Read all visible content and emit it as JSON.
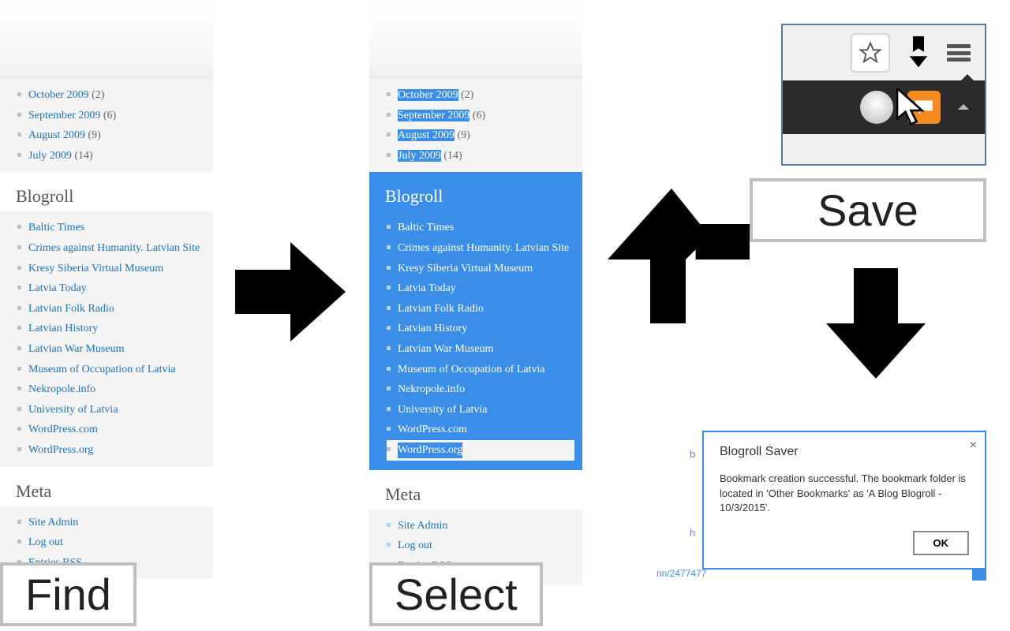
{
  "archives": [
    {
      "label": "October 2009",
      "count": "(2)"
    },
    {
      "label": "September 2009",
      "count": "(6)"
    },
    {
      "label": "August 2009",
      "count": "(9)"
    },
    {
      "label": "July 2009",
      "count": "(14)"
    }
  ],
  "blogroll": {
    "title": "Blogroll",
    "items": [
      "Baltic Times",
      "Crimes against Humanity. Latvian Site",
      "Kresy Siberia Virtual Museum",
      "Latvia Today",
      "Latvian Folk Radio",
      "Latvian History",
      "Latvian War Museum",
      "Museum of Occupation of Latvia",
      "Nekropole.info",
      "University of Latvia",
      "WordPress.com",
      "WordPress.org"
    ]
  },
  "meta": {
    "title": "Meta",
    "items": [
      "Site Admin",
      "Log out",
      "Entries RSS"
    ]
  },
  "steps": {
    "find": "Find",
    "select": "Select",
    "save": "Save"
  },
  "dialog": {
    "title": "Blogroll Saver",
    "body": "Bookmark creation successful. The bookmark folder is located in 'Other Bookmarks' as 'A Blog Blogroll - 10/3/2015'.",
    "ok": "OK",
    "close": "×",
    "side1": "b",
    "side2": "h",
    "side_bottom": "nn/2477477"
  }
}
